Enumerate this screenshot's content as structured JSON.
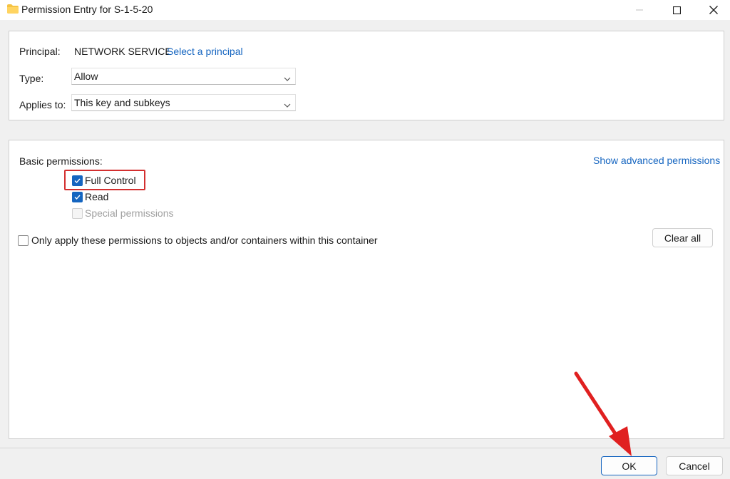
{
  "window": {
    "title": "Permission Entry for S-1-5-20",
    "icon": "folder-icon"
  },
  "principal": {
    "label": "Principal:",
    "value": "NETWORK SERVICE",
    "link": "Select a principal"
  },
  "type": {
    "label": "Type:",
    "selected": "Allow"
  },
  "applies_to": {
    "label": "Applies to:",
    "selected": "This key and subkeys"
  },
  "permissions": {
    "heading": "Basic permissions:",
    "advanced_link": "Show advanced permissions",
    "items": [
      {
        "label": "Full Control",
        "checked": true,
        "enabled": true
      },
      {
        "label": "Read",
        "checked": true,
        "enabled": true
      },
      {
        "label": "Special permissions",
        "checked": false,
        "enabled": false
      }
    ],
    "apply_only": {
      "label": "Only apply these permissions to objects and/or containers within this container",
      "checked": false
    },
    "clear_all": "Clear all"
  },
  "footer": {
    "ok": "OK",
    "cancel": "Cancel"
  },
  "colors": {
    "accent": "#1565c0",
    "highlight": "#d32f2f",
    "arrow": "#e02020"
  }
}
